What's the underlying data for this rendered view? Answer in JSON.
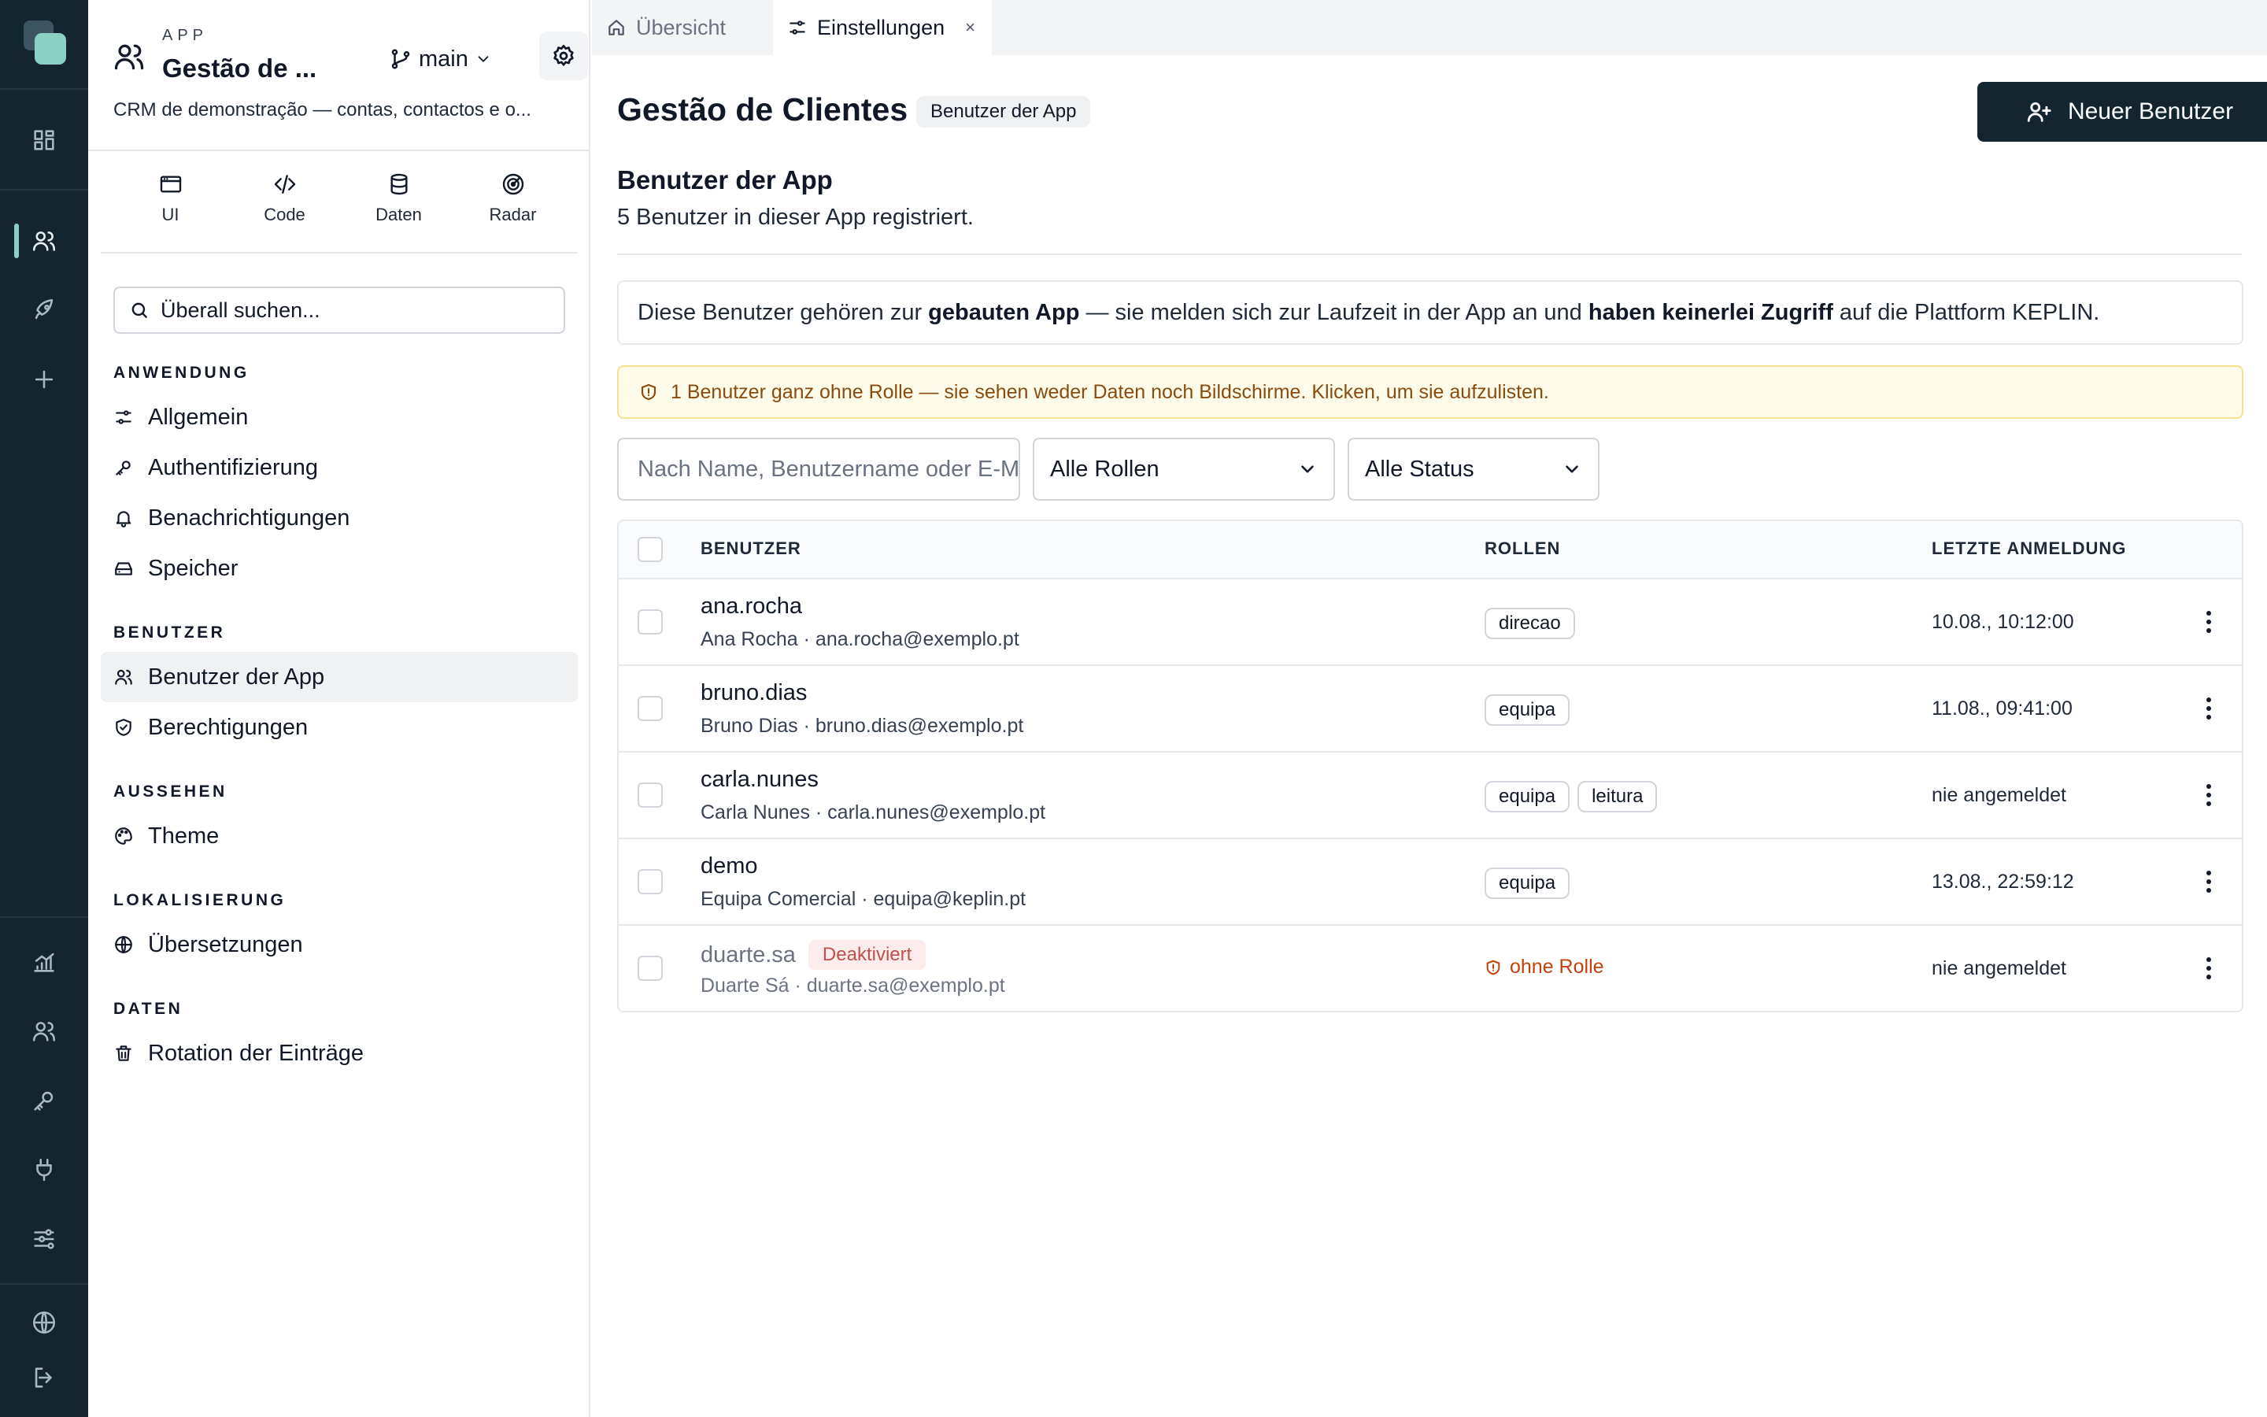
{
  "rail": {
    "icons": [
      "logo-icon",
      "dashboard-icon",
      "users-icon",
      "rocket-icon",
      "plus-icon",
      "analytics-icon",
      "team-icon",
      "key-icon",
      "plug-icon",
      "sliders-icon",
      "globe-icon",
      "logout-icon"
    ],
    "active": "users-icon",
    "accent": "#8ccfc3"
  },
  "app": {
    "kicker": "APP",
    "name": "Gestão de ...",
    "branch": "main",
    "description": "CRM de demonstração — contas, contactos e o..."
  },
  "modes": [
    {
      "label": "UI",
      "icon": "window-icon"
    },
    {
      "label": "Code",
      "icon": "code-icon"
    },
    {
      "label": "Daten",
      "icon": "database-icon"
    },
    {
      "label": "Radar",
      "icon": "radar-icon"
    }
  ],
  "search": {
    "placeholder": "Überall suchen..."
  },
  "nav": {
    "sections": [
      {
        "title": "ANWENDUNG",
        "items": [
          {
            "label": "Allgemein",
            "icon": "sliders-icon"
          },
          {
            "label": "Authentifizierung",
            "icon": "key-icon"
          },
          {
            "label": "Benachrichtigungen",
            "icon": "bell-icon"
          },
          {
            "label": "Speicher",
            "icon": "storage-icon"
          }
        ]
      },
      {
        "title": "BENUTZER",
        "items": [
          {
            "label": "Benutzer der App",
            "icon": "users-icon",
            "active": true
          },
          {
            "label": "Berechtigungen",
            "icon": "shield-check-icon"
          }
        ]
      },
      {
        "title": "AUSSEHEN",
        "items": [
          {
            "label": "Theme",
            "icon": "palette-icon"
          }
        ]
      },
      {
        "title": "LOKALISIERUNG",
        "items": [
          {
            "label": "Übersetzungen",
            "icon": "globe-icon"
          }
        ]
      },
      {
        "title": "DATEN",
        "items": [
          {
            "label": "Rotation der Einträge",
            "icon": "trash-icon"
          }
        ]
      }
    ]
  },
  "tabs": [
    {
      "label": "Übersicht",
      "icon": "home-icon",
      "active": false
    },
    {
      "label": "Einstellungen",
      "icon": "sliders-icon",
      "active": true,
      "close": "×"
    }
  ],
  "header": {
    "title": "Gestão de Clientes",
    "chip": "Benutzer der App",
    "new_user_label": "Neuer Benutzer"
  },
  "section": {
    "title": "Benutzer der App",
    "subtitle": "5 Benutzer in dieser App registriert."
  },
  "info": {
    "part1": "Diese Benutzer gehören zur ",
    "bold1": "gebauten App",
    "part2": " — sie melden sich zur Laufzeit in der App an und ",
    "bold2": "haben keinerlei Zugriff",
    "part3": " auf die Plattform KEPLIN."
  },
  "warning": {
    "text": "1 Benutzer ganz ohne Rolle — sie sehen weder Daten noch Bildschirme. Klicken, um sie aufzulisten.",
    "color": "#8a4b10"
  },
  "filters": {
    "search_placeholder": "Nach Name, Benutzername oder E-Mail",
    "roles_value": "Alle Rollen",
    "status_value": "Alle Status"
  },
  "table": {
    "columns": [
      "BENUTZER",
      "ROLLEN",
      "LETZTE ANMELDUNG"
    ],
    "rows": [
      {
        "username": "ana.rocha",
        "sub": "Ana Rocha · ana.rocha@exemplo.pt",
        "roles": [
          "direcao"
        ],
        "last": "10.08., 10:12:00"
      },
      {
        "username": "bruno.dias",
        "sub": "Bruno Dias · bruno.dias@exemplo.pt",
        "roles": [
          "equipa"
        ],
        "last": "11.08., 09:41:00"
      },
      {
        "username": "carla.nunes",
        "sub": "Carla Nunes · carla.nunes@exemplo.pt",
        "roles": [
          "equipa",
          "leitura"
        ],
        "last": "nie angemeldet"
      },
      {
        "username": "demo",
        "sub": "Equipa Comercial · equipa@keplin.pt",
        "roles": [
          "equipa"
        ],
        "last": "13.08., 22:59:12"
      },
      {
        "username": "duarte.sa",
        "sub": "Duarte Sá · duarte.sa@exemplo.pt",
        "badge": "Deaktiviert",
        "no_role": "ohne Rolle",
        "last": "nie angemeldet"
      }
    ]
  }
}
